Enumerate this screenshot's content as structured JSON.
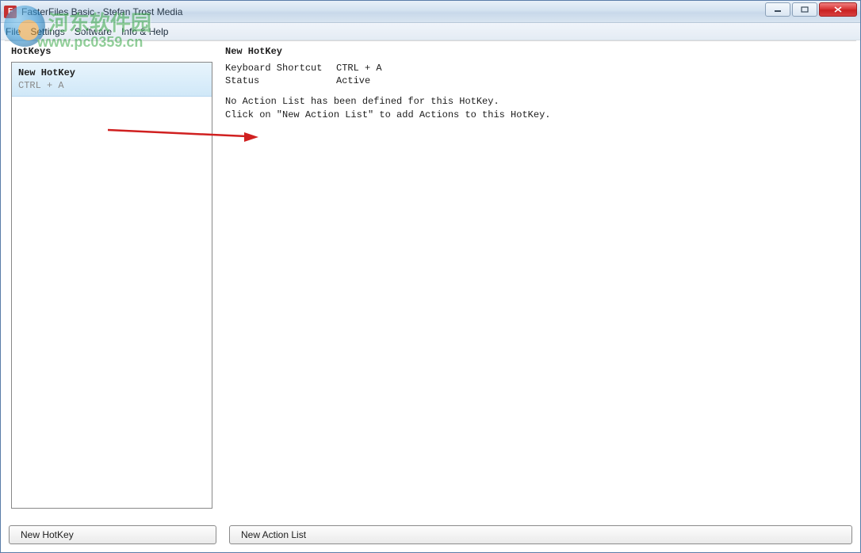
{
  "window": {
    "title": "FasterFiles Basic - Stefan Trost Media"
  },
  "menu": {
    "file": "File",
    "settings": "Settings",
    "software": "Software",
    "info": "Info & Help"
  },
  "left": {
    "header": "HotKeys",
    "items": [
      {
        "name": "New HotKey",
        "shortcut": "CTRL + A"
      }
    ],
    "button": "New HotKey"
  },
  "right": {
    "header": "New HotKey",
    "rows": {
      "shortcut_label": "Keyboard Shortcut",
      "shortcut_value": "CTRL + A",
      "status_label": "Status",
      "status_value": "Active"
    },
    "message_line1": "No Action List has been defined for this HotKey.",
    "message_line2": "Click on \"New Action List\" to add Actions to this HotKey.",
    "button": "New Action List"
  },
  "watermark": {
    "line1": "河东软件园",
    "line2": "www.pc0359.cn"
  }
}
